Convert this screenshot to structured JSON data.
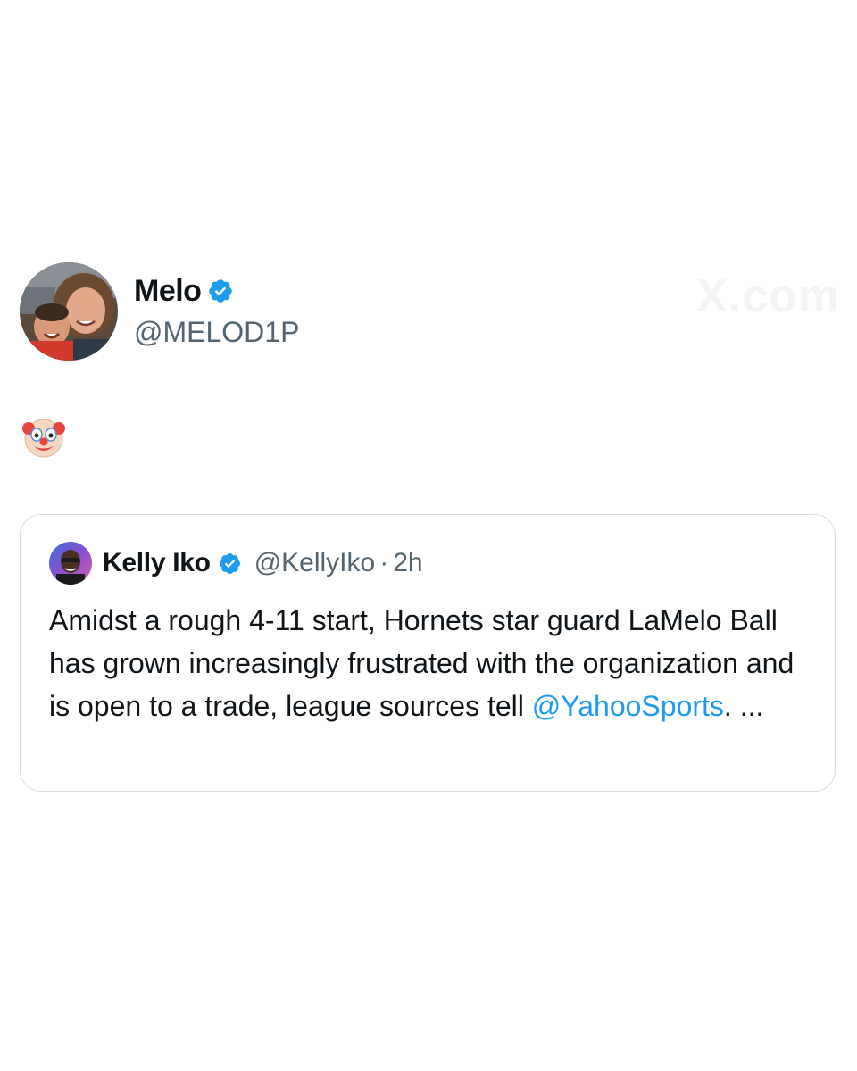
{
  "watermark": "X.com",
  "author": {
    "display_name": "Melo",
    "handle": "@MELOD1P",
    "verified": true,
    "avatar_icon": "profile-photo-avatar"
  },
  "tweet": {
    "emoji": "🤡",
    "emoji_icon": "clown-face-icon"
  },
  "quote": {
    "display_name": "Kelly Iko",
    "handle": "@KellyIko",
    "separator": "·",
    "time": "2h",
    "verified": true,
    "avatar_icon": "profile-photo-avatar",
    "text_before": "Amidst a rough 4-11 start, Hornets star guard LaMelo Ball has grown increasingly frustrated with the organization and is open to a trade, league sources tell ",
    "mention": "@YahooSports",
    "text_after": ". ..."
  },
  "colors": {
    "verified_badge": "#1d9bf0",
    "link": "#1d9bf0",
    "secondary_text": "#536471",
    "primary_text": "#0f1419",
    "card_border": "#d6dde3"
  }
}
